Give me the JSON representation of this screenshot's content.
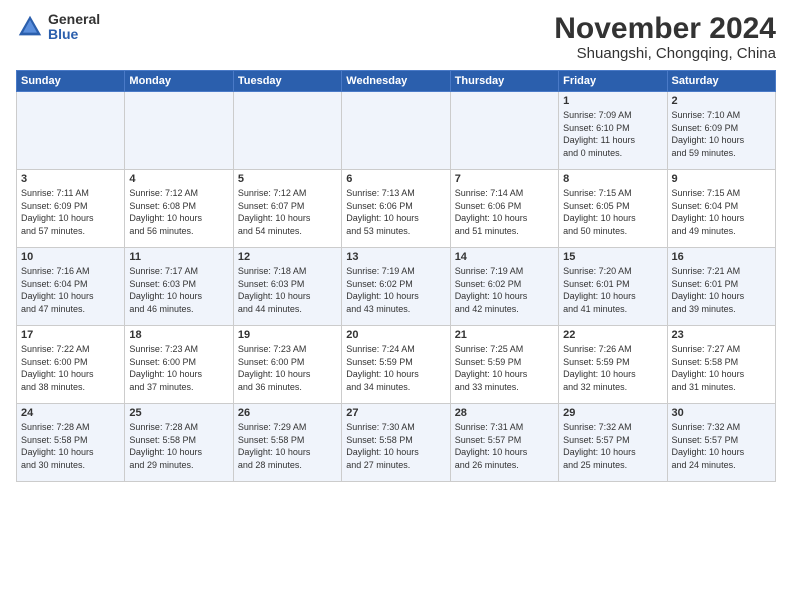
{
  "header": {
    "logo_general": "General",
    "logo_blue": "Blue",
    "month": "November 2024",
    "location": "Shuangshi, Chongqing, China"
  },
  "weekdays": [
    "Sunday",
    "Monday",
    "Tuesday",
    "Wednesday",
    "Thursday",
    "Friday",
    "Saturday"
  ],
  "weeks": [
    [
      {
        "day": "",
        "info": ""
      },
      {
        "day": "",
        "info": ""
      },
      {
        "day": "",
        "info": ""
      },
      {
        "day": "",
        "info": ""
      },
      {
        "day": "",
        "info": ""
      },
      {
        "day": "1",
        "info": "Sunrise: 7:09 AM\nSunset: 6:10 PM\nDaylight: 11 hours\nand 0 minutes."
      },
      {
        "day": "2",
        "info": "Sunrise: 7:10 AM\nSunset: 6:09 PM\nDaylight: 10 hours\nand 59 minutes."
      }
    ],
    [
      {
        "day": "3",
        "info": "Sunrise: 7:11 AM\nSunset: 6:09 PM\nDaylight: 10 hours\nand 57 minutes."
      },
      {
        "day": "4",
        "info": "Sunrise: 7:12 AM\nSunset: 6:08 PM\nDaylight: 10 hours\nand 56 minutes."
      },
      {
        "day": "5",
        "info": "Sunrise: 7:12 AM\nSunset: 6:07 PM\nDaylight: 10 hours\nand 54 minutes."
      },
      {
        "day": "6",
        "info": "Sunrise: 7:13 AM\nSunset: 6:06 PM\nDaylight: 10 hours\nand 53 minutes."
      },
      {
        "day": "7",
        "info": "Sunrise: 7:14 AM\nSunset: 6:06 PM\nDaylight: 10 hours\nand 51 minutes."
      },
      {
        "day": "8",
        "info": "Sunrise: 7:15 AM\nSunset: 6:05 PM\nDaylight: 10 hours\nand 50 minutes."
      },
      {
        "day": "9",
        "info": "Sunrise: 7:15 AM\nSunset: 6:04 PM\nDaylight: 10 hours\nand 49 minutes."
      }
    ],
    [
      {
        "day": "10",
        "info": "Sunrise: 7:16 AM\nSunset: 6:04 PM\nDaylight: 10 hours\nand 47 minutes."
      },
      {
        "day": "11",
        "info": "Sunrise: 7:17 AM\nSunset: 6:03 PM\nDaylight: 10 hours\nand 46 minutes."
      },
      {
        "day": "12",
        "info": "Sunrise: 7:18 AM\nSunset: 6:03 PM\nDaylight: 10 hours\nand 44 minutes."
      },
      {
        "day": "13",
        "info": "Sunrise: 7:19 AM\nSunset: 6:02 PM\nDaylight: 10 hours\nand 43 minutes."
      },
      {
        "day": "14",
        "info": "Sunrise: 7:19 AM\nSunset: 6:02 PM\nDaylight: 10 hours\nand 42 minutes."
      },
      {
        "day": "15",
        "info": "Sunrise: 7:20 AM\nSunset: 6:01 PM\nDaylight: 10 hours\nand 41 minutes."
      },
      {
        "day": "16",
        "info": "Sunrise: 7:21 AM\nSunset: 6:01 PM\nDaylight: 10 hours\nand 39 minutes."
      }
    ],
    [
      {
        "day": "17",
        "info": "Sunrise: 7:22 AM\nSunset: 6:00 PM\nDaylight: 10 hours\nand 38 minutes."
      },
      {
        "day": "18",
        "info": "Sunrise: 7:23 AM\nSunset: 6:00 PM\nDaylight: 10 hours\nand 37 minutes."
      },
      {
        "day": "19",
        "info": "Sunrise: 7:23 AM\nSunset: 6:00 PM\nDaylight: 10 hours\nand 36 minutes."
      },
      {
        "day": "20",
        "info": "Sunrise: 7:24 AM\nSunset: 5:59 PM\nDaylight: 10 hours\nand 34 minutes."
      },
      {
        "day": "21",
        "info": "Sunrise: 7:25 AM\nSunset: 5:59 PM\nDaylight: 10 hours\nand 33 minutes."
      },
      {
        "day": "22",
        "info": "Sunrise: 7:26 AM\nSunset: 5:59 PM\nDaylight: 10 hours\nand 32 minutes."
      },
      {
        "day": "23",
        "info": "Sunrise: 7:27 AM\nSunset: 5:58 PM\nDaylight: 10 hours\nand 31 minutes."
      }
    ],
    [
      {
        "day": "24",
        "info": "Sunrise: 7:28 AM\nSunset: 5:58 PM\nDaylight: 10 hours\nand 30 minutes."
      },
      {
        "day": "25",
        "info": "Sunrise: 7:28 AM\nSunset: 5:58 PM\nDaylight: 10 hours\nand 29 minutes."
      },
      {
        "day": "26",
        "info": "Sunrise: 7:29 AM\nSunset: 5:58 PM\nDaylight: 10 hours\nand 28 minutes."
      },
      {
        "day": "27",
        "info": "Sunrise: 7:30 AM\nSunset: 5:58 PM\nDaylight: 10 hours\nand 27 minutes."
      },
      {
        "day": "28",
        "info": "Sunrise: 7:31 AM\nSunset: 5:57 PM\nDaylight: 10 hours\nand 26 minutes."
      },
      {
        "day": "29",
        "info": "Sunrise: 7:32 AM\nSunset: 5:57 PM\nDaylight: 10 hours\nand 25 minutes."
      },
      {
        "day": "30",
        "info": "Sunrise: 7:32 AM\nSunset: 5:57 PM\nDaylight: 10 hours\nand 24 minutes."
      }
    ]
  ]
}
